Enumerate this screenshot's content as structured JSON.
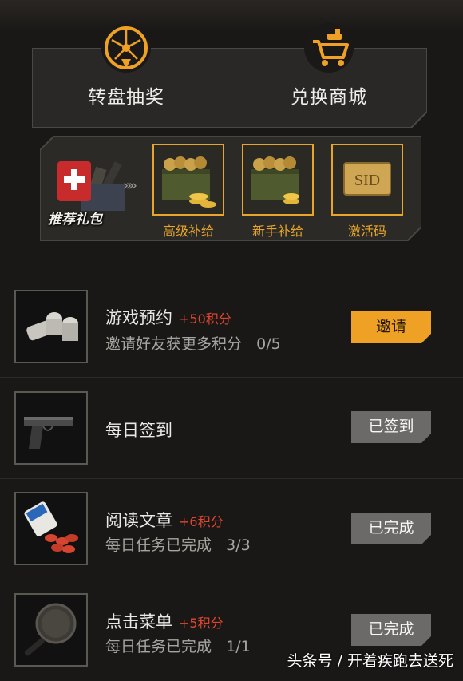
{
  "nav": {
    "items": [
      {
        "label": "转盘抽奖",
        "icon": "wheel-icon"
      },
      {
        "label": "兑换商城",
        "icon": "shop-cart-icon"
      }
    ]
  },
  "gift": {
    "label": "推荐礼包",
    "arrows": "»»",
    "items": [
      {
        "caption": "高级补给",
        "icon": "gold-supply-crate-icon"
      },
      {
        "caption": "新手补给",
        "icon": "supply-crate-icon"
      },
      {
        "caption": "激活码",
        "icon": "activation-card-icon",
        "card_text": "SID"
      }
    ]
  },
  "tasks": [
    {
      "title": "游戏预约",
      "points": "+50积分",
      "subtitle": "邀请好友获更多积分",
      "progress": "0/5",
      "button": "邀请",
      "button_style": "orange",
      "icon": "canned-food-icon"
    },
    {
      "title": "每日签到",
      "points": "",
      "subtitle": "",
      "progress": "",
      "button": "已签到",
      "button_style": "grey",
      "icon": "pistol-icon"
    },
    {
      "title": "阅读文章",
      "points": "+6积分",
      "subtitle": "每日任务已完成",
      "progress": "3/3",
      "button": "已完成",
      "button_style": "grey",
      "icon": "pill-bottle-icon"
    },
    {
      "title": "点击菜单",
      "points": "+5积分",
      "subtitle": "每日任务已完成",
      "progress": "1/1",
      "button": "已完成",
      "button_style": "grey",
      "icon": "frying-pan-icon"
    }
  ],
  "watermark": "头条号 / 开着疾跑去送死",
  "colors": {
    "accent": "#efa126",
    "points": "#e2452f",
    "background": "#191816",
    "button_done": "#6b6a68"
  }
}
